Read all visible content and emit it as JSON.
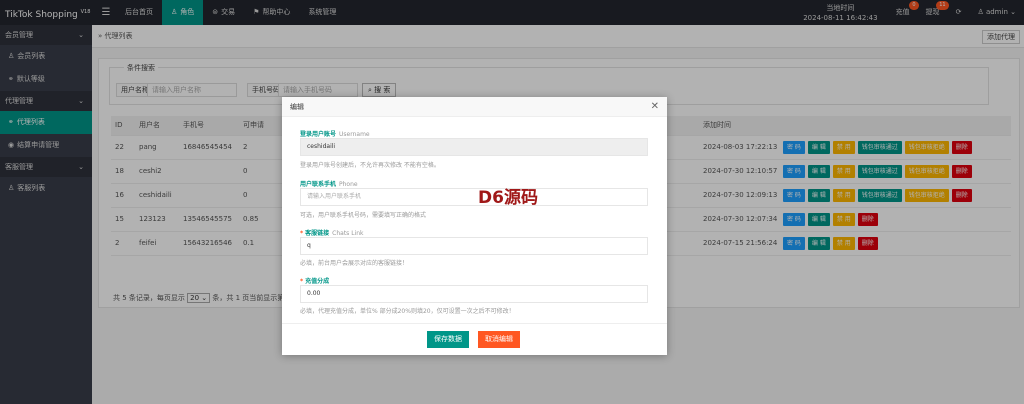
{
  "app": {
    "brand": "TikTok Shopping",
    "version": "V18"
  },
  "topnav": {
    "items": [
      {
        "label": "后台首页",
        "icon": ""
      },
      {
        "label": "角色",
        "icon": "user-icon"
      },
      {
        "label": "交易",
        "icon": "shopping-icon"
      },
      {
        "label": "帮助中心",
        "icon": "flag-icon"
      },
      {
        "label": "系统管理",
        "icon": ""
      }
    ],
    "time_label": "当地时间",
    "time_value": "2024-08-11 16:42:43",
    "recharge_label": "充值",
    "recharge_badge": "0",
    "withdraw_label": "提现",
    "withdraw_badge": "11",
    "user_label": "admin"
  },
  "sidebar": {
    "groups": [
      {
        "label": "会员管理",
        "items": [
          {
            "label": "会员列表"
          },
          {
            "label": "默认等级"
          }
        ]
      },
      {
        "label": "代理管理",
        "items": [
          {
            "label": "代理列表"
          },
          {
            "label": "结算申请管理"
          }
        ]
      },
      {
        "label": "客服管理",
        "items": [
          {
            "label": "客服列表"
          }
        ]
      }
    ]
  },
  "tabbar": {
    "current": "代理列表",
    "add_button": "添加代理"
  },
  "search": {
    "legend": "条件搜索",
    "username_label": "用户名称",
    "username_placeholder": "请输入用户名称",
    "phone_label": "手机号码",
    "phone_placeholder": "请输入手机号码",
    "search_button": "搜 索"
  },
  "table": {
    "headers": [
      "ID",
      "用户名",
      "手机号",
      "可申请",
      "添加时间"
    ],
    "rows": [
      {
        "id": "22",
        "username": "pang",
        "phone": "16846545454",
        "available": "2",
        "time": "2024-08-03 17:22:13",
        "wide": true
      },
      {
        "id": "18",
        "username": "ceshi2",
        "phone": "",
        "available": "0",
        "time": "2024-07-30 12:10:57",
        "wide": true
      },
      {
        "id": "16",
        "username": "ceshidaili",
        "phone": "",
        "available": "0",
        "time": "2024-07-30 12:09:13",
        "wide": true
      },
      {
        "id": "15",
        "username": "123123",
        "phone": "13546545575",
        "available": "0.85",
        "time": "2024-07-30 12:07:34",
        "wide": false
      },
      {
        "id": "2",
        "username": "feifei",
        "phone": "15643216546",
        "available": "0.1",
        "time": "2024-07-15 21:56:24",
        "wide": false
      }
    ],
    "ops": {
      "password": "密 码",
      "edit": "编 辑",
      "disable": "禁 用",
      "pass_audit": "钱包审核通过",
      "reject_audit": "钱包审核拒绝",
      "delete": "删除"
    }
  },
  "pager": {
    "prefix": "共 5 条记录，每页显示",
    "page_size": "20",
    "suffix": "条，共 1 页当前显示第 1 页。"
  },
  "modal": {
    "title": "编辑",
    "username": {
      "label": "登录用户账号",
      "en": "Username",
      "value": "ceshidaili",
      "hint": "登录用户账号创建后，不允许再次修改 不能有空格。"
    },
    "phone": {
      "label": "用户联系手机",
      "en": "Phone",
      "placeholder": "请输入用户联系手机",
      "hint": "可选，用户联系手机号码，需要填写正确的格式"
    },
    "chat": {
      "label": "客服链接",
      "en": "Chats Link",
      "value": "q",
      "hint": "必填，前台用户会展示对应的客服链接！"
    },
    "commission": {
      "label": "充值分成",
      "value": "0.00",
      "hint": "必填，代理充值分成，单位% 部分成20%则填20，仅可设置一次之后不可修改！"
    },
    "save_button": "保存数据",
    "cancel_button": "取消编辑"
  },
  "watermark": "D6源码",
  "colors": {
    "teal": "#009688",
    "blue": "#1e9fff",
    "orange": "#ffb800",
    "red": "#ff5722",
    "darkred": "#e0000d"
  }
}
